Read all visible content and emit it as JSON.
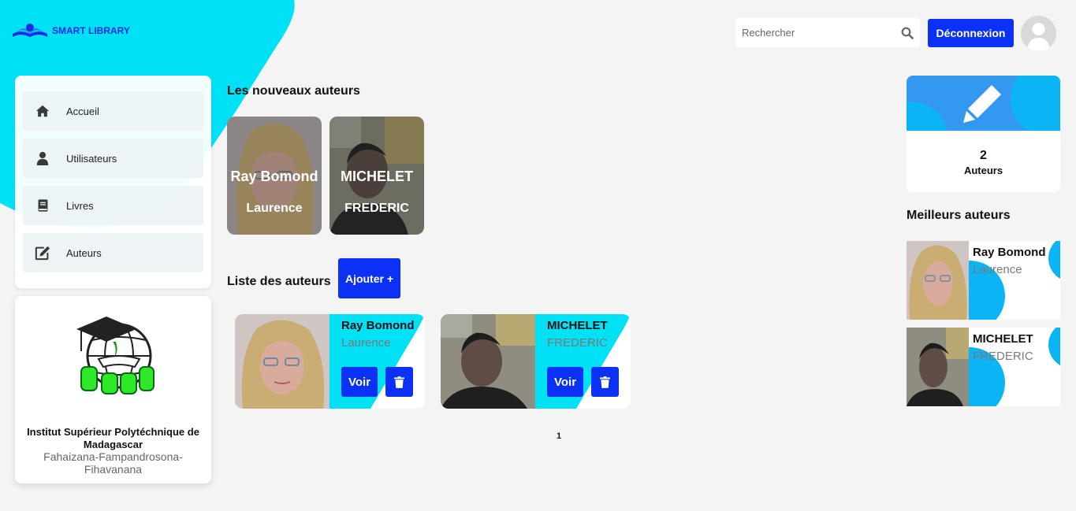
{
  "brand": {
    "name": "SMART LIBRARY"
  },
  "header": {
    "search_placeholder": "Rechercher",
    "logout_label": "Déconnexion"
  },
  "sidebar": {
    "items": [
      {
        "label": "Accueil",
        "icon": "home-icon"
      },
      {
        "label": "Utilisateurs",
        "icon": "user-icon"
      },
      {
        "label": "Livres",
        "icon": "book-icon"
      },
      {
        "label": "Auteurs",
        "icon": "edit-icon"
      }
    ]
  },
  "institute": {
    "name": "Institut Supérieur Polytéchnique de Madagascar",
    "location": "Fahaizana-Fampandrosona-Fihavanana"
  },
  "new_authors": {
    "title": "Les nouveaux auteurs",
    "items": [
      {
        "name": "Ray Bomond",
        "firstname": "Laurence"
      },
      {
        "name": "MICHELET",
        "firstname": "FREDERIC"
      }
    ]
  },
  "author_list": {
    "title": "Liste des auteurs",
    "add_label": "Ajouter +",
    "items": [
      {
        "name": "Ray Bomond",
        "firstname": "Laurence",
        "view_label": "Voir"
      },
      {
        "name": "MICHELET",
        "firstname": "FREDERIC",
        "view_label": "Voir"
      }
    ],
    "pagination": {
      "current": "1"
    }
  },
  "stats": {
    "count": "2",
    "label": "Auteurs"
  },
  "best_authors": {
    "title": "Meilleurs auteurs",
    "items": [
      {
        "name": "Ray Bomond",
        "firstname": "Laurence"
      },
      {
        "name": "MICHELET",
        "firstname": "FREDERIC"
      }
    ]
  },
  "colors": {
    "accent": "#0a31f5",
    "cyan": "#00e1f5",
    "sky": "#0bb5f5"
  }
}
